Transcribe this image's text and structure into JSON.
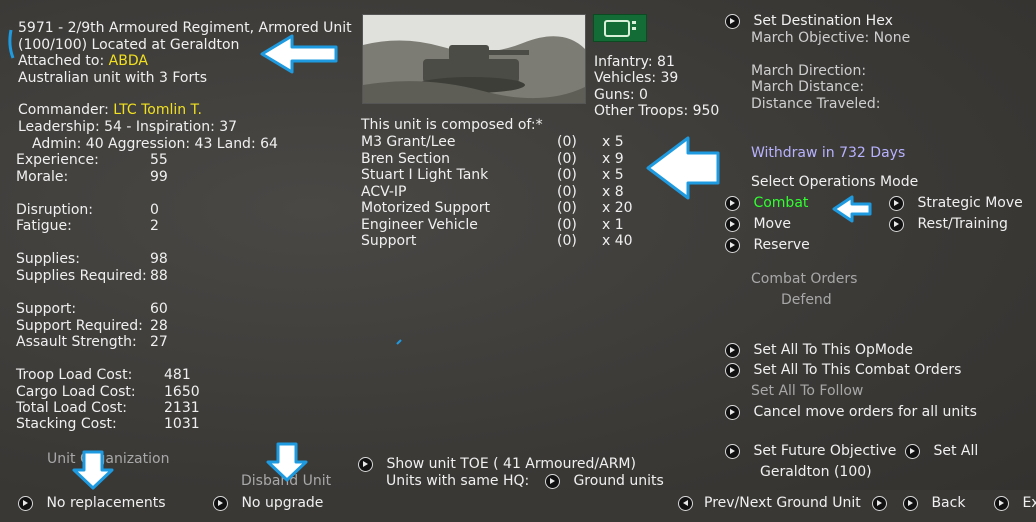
{
  "unit": {
    "header_line1": "5971 - 2/9th Armoured Regiment, Armored Unit",
    "header_line2": "(100/100) Located at  Geraldton",
    "attached_label": "Attached to: ",
    "attached_value": "ABDA",
    "nationality_line": "Australian unit with 3 Forts"
  },
  "commander": {
    "label": "Commander: ",
    "name": "LTC Tomlin T.",
    "leadership_line": "Leadership: 54 - Inspiration: 37",
    "admin_line": "Admin: 40  Aggression: 43 Land: 64"
  },
  "stats": [
    {
      "label": "Experience:",
      "value": "55"
    },
    {
      "label": "Morale:",
      "value": "99"
    },
    {
      "label": "Disruption:",
      "value": "0"
    },
    {
      "label": "Fatigue:",
      "value": "2"
    },
    {
      "label": "Supplies:",
      "value": "98"
    },
    {
      "label": "Supplies Required:",
      "value": "88"
    },
    {
      "label": "Support:",
      "value": "60"
    },
    {
      "label": "Support Required:",
      "value": "28"
    },
    {
      "label": "Assault Strength:",
      "value": "27"
    },
    {
      "label": "Troop Load Cost:",
      "value": "481"
    },
    {
      "label": "Cargo Load Cost:",
      "value": "1650"
    },
    {
      "label": "Total Load Cost:",
      "value": "2131"
    },
    {
      "label": "Stacking Cost:",
      "value": "1031"
    }
  ],
  "troops": {
    "infantry": "Infantry: 81",
    "vehicles": "Vehicles: 39",
    "guns": "Guns: 0",
    "other": "Other Troops: 950"
  },
  "composition": {
    "title": "This unit is composed of:*",
    "rows": [
      {
        "name": "M3 Grant/Lee",
        "damaged": "(0)",
        "count": "x 5"
      },
      {
        "name": "Bren Section",
        "damaged": "(0)",
        "count": "x 9"
      },
      {
        "name": "Stuart I Light Tank",
        "damaged": "(0)",
        "count": "x 5"
      },
      {
        "name": "ACV-IP",
        "damaged": "(0)",
        "count": "x 8"
      },
      {
        "name": "Motorized Support",
        "damaged": "(0)",
        "count": "x 20"
      },
      {
        "name": "Engineer Vehicle",
        "damaged": "(0)",
        "count": "x 1"
      },
      {
        "name": "Support",
        "damaged": "(0)",
        "count": "x 40"
      }
    ]
  },
  "march": {
    "set_destination": "Set Destination Hex",
    "objective": "March Objective: None",
    "direction": "March Direction:",
    "distance": "March Distance:",
    "traveled": "Distance Traveled:"
  },
  "withdraw": "Withdraw in 732 Days",
  "ops": {
    "title": "Select Operations Mode",
    "combat": "Combat",
    "move": "Move",
    "reserve": "Reserve",
    "strategic": "Strategic Move",
    "rest": "Rest/Training",
    "orders_title": "Combat Orders",
    "orders_value": "Defend"
  },
  "actions": {
    "set_all_opmode": "Set All To This OpMode",
    "set_all_combat": "Set All To This Combat Orders",
    "set_all_follow": "Set All To Follow",
    "cancel_move": "Cancel move orders for all units",
    "set_future": "Set Future Objective",
    "set_all": "Set All",
    "future_value": "Geraldton (100)"
  },
  "bottom": {
    "unit_org": "Unit Organization",
    "disband": "Disband Unit",
    "no_replacements": "No replacements",
    "no_upgrade": "No upgrade",
    "show_toe": "Show unit TOE ( 41 Armoured/ARM)",
    "same_hq": "Units with same HQ:",
    "ground_units": "Ground units",
    "prev_next": "Prev/Next Ground Unit",
    "back": "Back",
    "exit": "Ex"
  },
  "colors": {
    "background": "#3f3d3a",
    "highlight_yellow": "#f0e020",
    "withdraw_purple": "#b7b2ff",
    "combat_green": "#30ff30",
    "annotation_blue": "#1e9be0"
  }
}
